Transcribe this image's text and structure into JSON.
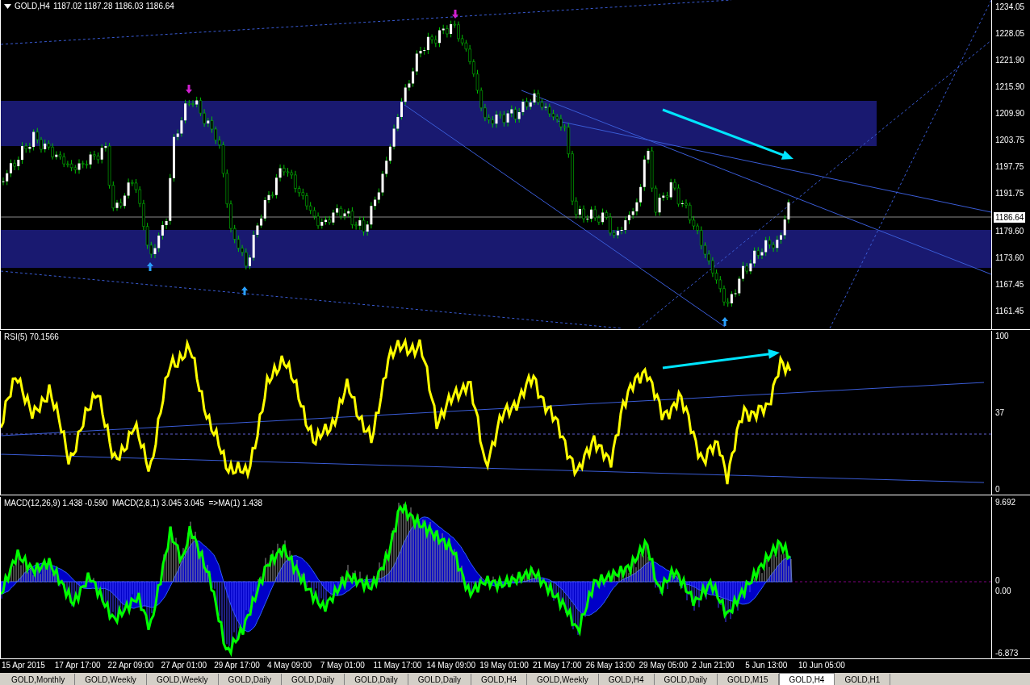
{
  "chart_header": {
    "symbol": "GOLD,H4",
    "quotes": "1187.02 1187.28 1186.03 1186.64"
  },
  "price_axis": {
    "ticks": [
      "1234.05",
      "1228.05",
      "1221.90",
      "1215.90",
      "1209.90",
      "1203.75",
      "1197.75",
      "1191.75",
      "1179.60",
      "1173.60",
      "1167.45",
      "1161.45"
    ],
    "current_price": "1186.64"
  },
  "rsi_pane": {
    "header": "RSI(5) 70.1566",
    "ticks": [
      "100",
      "37",
      "0"
    ]
  },
  "macd_pane": {
    "header": "MACD(12,26,9) 1.438 -0.590  MACD(2,8,1) 3.045 3.045  =>MA(1) 1.438",
    "ticks": [
      "9.692",
      "0",
      "0.00",
      "-6.873"
    ]
  },
  "time_axis": [
    "15 Apr 2015",
    "17 Apr 17:00",
    "22 Apr 09:00",
    "27 Apr 01:00",
    "29 Apr 17:00",
    "4 May 09:00",
    "7 May 01:00",
    "11 May 17:00",
    "14 May 09:00",
    "19 May 01:00",
    "21 May 17:00",
    "26 May 13:00",
    "29 May 05:00",
    "2 Jun 21:00",
    "5 Jun 13:00",
    "10 Jun 05:00"
  ],
  "tabs": [
    {
      "label": "GOLD,Monthly",
      "selected": false
    },
    {
      "label": "GOLD,Weekly",
      "selected": false
    },
    {
      "label": "GOLD,Weekly",
      "selected": false
    },
    {
      "label": "GOLD,Daily",
      "selected": false
    },
    {
      "label": "GOLD,Daily",
      "selected": false
    },
    {
      "label": "GOLD,Daily",
      "selected": false
    },
    {
      "label": "GOLD,Daily",
      "selected": false
    },
    {
      "label": "GOLD,H4",
      "selected": false
    },
    {
      "label": "GOLD,Weekly",
      "selected": false
    },
    {
      "label": "GOLD,H4",
      "selected": false
    },
    {
      "label": "GOLD,Daily",
      "selected": false
    },
    {
      "label": "GOLD,M15",
      "selected": false
    },
    {
      "label": "GOLD,H4",
      "selected": true
    },
    {
      "label": "GOLD,H1",
      "selected": false
    }
  ]
}
